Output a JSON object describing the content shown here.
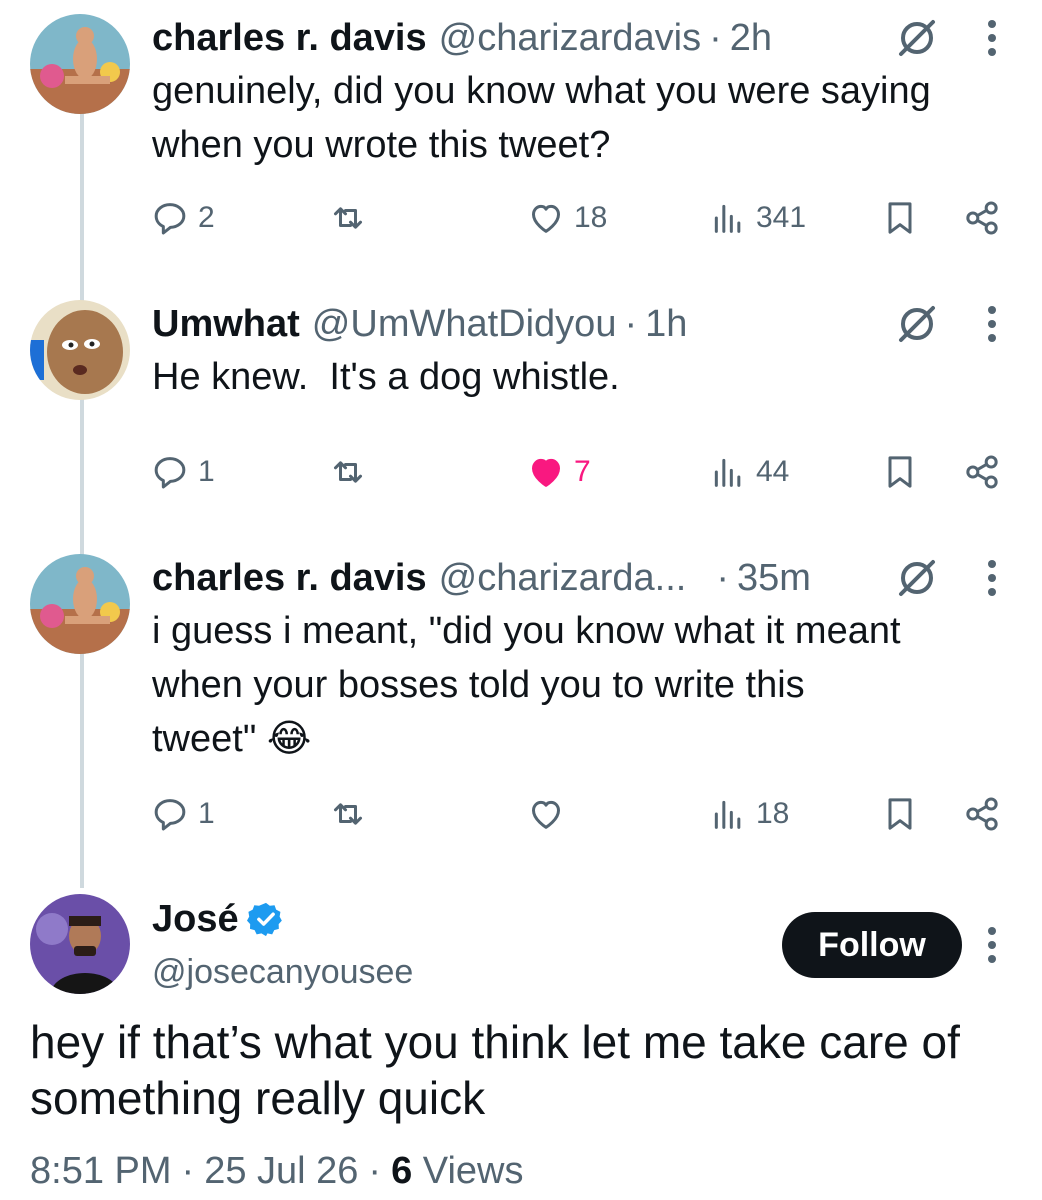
{
  "thread": {
    "replies": [
      {
        "name": "charles r. davis",
        "handle": "@charizardavis",
        "time": "2h",
        "text_lines": [
          "genuinely, did you know what you were saying",
          "when you wrote this tweet?"
        ],
        "stats": {
          "replies": "2",
          "likes": "18",
          "views": "341"
        },
        "liked": false
      },
      {
        "name": "Umwhat",
        "handle": "@UmWhatDidyou",
        "time": "1h",
        "text_lines": [
          "He knew.  It's a dog whistle."
        ],
        "stats": {
          "replies": "1",
          "likes": "7",
          "views": "44"
        },
        "liked": true
      },
      {
        "name": "charles r. davis",
        "handle": "@charizarda...",
        "time": "35m",
        "text_lines": [
          "i guess i meant, \"did you know what it meant",
          "when your bosses told you to write this",
          "tweet\" 😂"
        ],
        "stats": {
          "replies": "1",
          "likes": "",
          "views": "18"
        },
        "liked": false
      }
    ]
  },
  "main_tweet": {
    "name": "José",
    "handle": "@josecanyousee",
    "follow_label": "Follow",
    "text_lines": [
      "hey if that’s what you think let me take care of",
      "something really quick"
    ],
    "time": "8:51 PM",
    "date": "25 Jul 26",
    "views_count": "6",
    "views_label": "Views"
  },
  "colors": {
    "text": "#0f1419",
    "muted": "#536471",
    "like": "#f91880",
    "verified": "#1d9bf0",
    "thread_line": "#cfd9de"
  },
  "icons": {
    "reply": "reply-icon",
    "repost": "repost-icon",
    "like": "heart-icon",
    "views": "views-icon",
    "bookmark": "bookmark-icon",
    "share": "share-icon",
    "grok": "grok-icon",
    "more": "more-icon"
  }
}
